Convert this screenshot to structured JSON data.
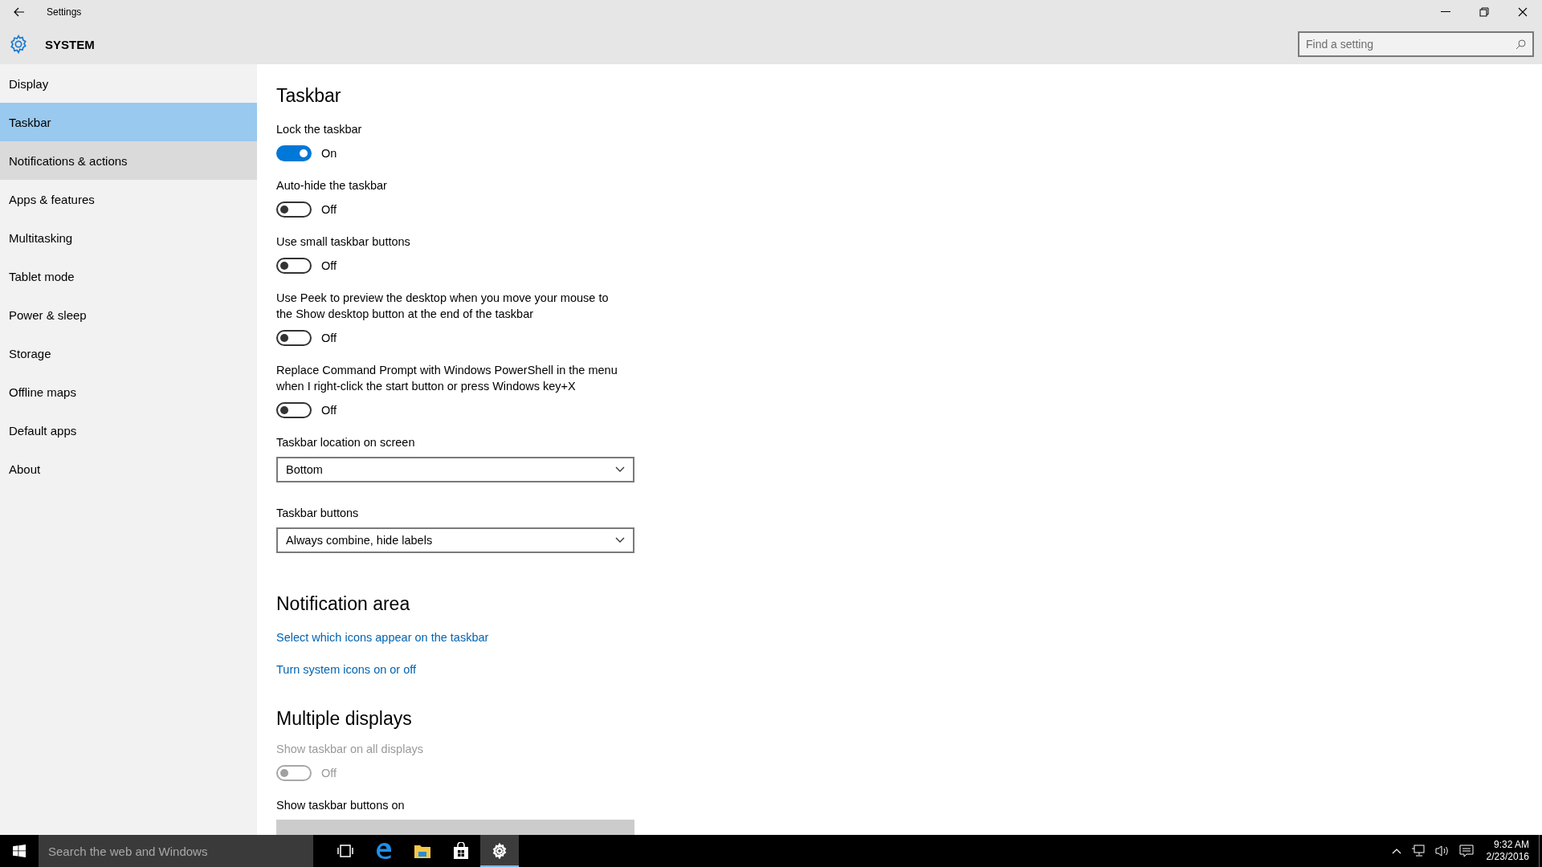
{
  "window": {
    "title": "Settings"
  },
  "header": {
    "title": "SYSTEM",
    "search": {
      "placeholder": "Find a setting"
    }
  },
  "sidebar": {
    "items": [
      {
        "label": "Display",
        "selected": false,
        "hovered": false
      },
      {
        "label": "Taskbar",
        "selected": true,
        "hovered": false
      },
      {
        "label": "Notifications & actions",
        "selected": false,
        "hovered": true
      },
      {
        "label": "Apps & features",
        "selected": false,
        "hovered": false
      },
      {
        "label": "Multitasking",
        "selected": false,
        "hovered": false
      },
      {
        "label": "Tablet mode",
        "selected": false,
        "hovered": false
      },
      {
        "label": "Power & sleep",
        "selected": false,
        "hovered": false
      },
      {
        "label": "Storage",
        "selected": false,
        "hovered": false
      },
      {
        "label": "Offline maps",
        "selected": false,
        "hovered": false
      },
      {
        "label": "Default apps",
        "selected": false,
        "hovered": false
      },
      {
        "label": "About",
        "selected": false,
        "hovered": false
      }
    ]
  },
  "content": [
    {
      "kind": "title",
      "text": "Taskbar"
    },
    {
      "kind": "toggle",
      "label": "Lock the taskbar",
      "on": true,
      "disabled": false,
      "state_text": "On"
    },
    {
      "kind": "toggle",
      "label": "Auto-hide the taskbar",
      "on": false,
      "disabled": false,
      "state_text": "Off"
    },
    {
      "kind": "toggle",
      "label": "Use small taskbar buttons",
      "on": false,
      "disabled": false,
      "state_text": "Off"
    },
    {
      "kind": "toggle",
      "label": "Use Peek to preview the desktop when you move your mouse to the Show desktop button at the end of the taskbar",
      "on": false,
      "disabled": false,
      "state_text": "Off"
    },
    {
      "kind": "toggle",
      "label": "Replace Command Prompt with Windows PowerShell in the menu when I right-click the start button or press Windows key+X",
      "on": false,
      "disabled": false,
      "state_text": "Off"
    },
    {
      "kind": "dropdown",
      "label": "Taskbar location on screen",
      "value": "Bottom",
      "disabled": false
    },
    {
      "kind": "dropdown",
      "label": "Taskbar buttons",
      "value": "Always combine, hide labels",
      "disabled": false
    },
    {
      "kind": "heading",
      "text": "Notification area"
    },
    {
      "kind": "link",
      "text": "Select which icons appear on the taskbar"
    },
    {
      "kind": "link",
      "text": "Turn system icons on or off"
    },
    {
      "kind": "heading",
      "text": "Multiple displays"
    },
    {
      "kind": "toggle",
      "label": "Show taskbar on all displays",
      "on": false,
      "disabled": true,
      "state_text": "Off"
    },
    {
      "kind": "dropdown",
      "label": "Show taskbar buttons on",
      "disabled": true
    }
  ],
  "taskbar": {
    "search": {
      "placeholder": "Search the web and Windows"
    },
    "apps": [
      {
        "kind": "task-view",
        "active": false
      },
      {
        "kind": "browser",
        "active": false
      },
      {
        "kind": "folder",
        "active": false
      },
      {
        "kind": "store",
        "active": false
      },
      {
        "kind": "settings",
        "active": true
      }
    ],
    "clock": {
      "time": "9:32 AM",
      "date": "2/23/2016"
    }
  }
}
